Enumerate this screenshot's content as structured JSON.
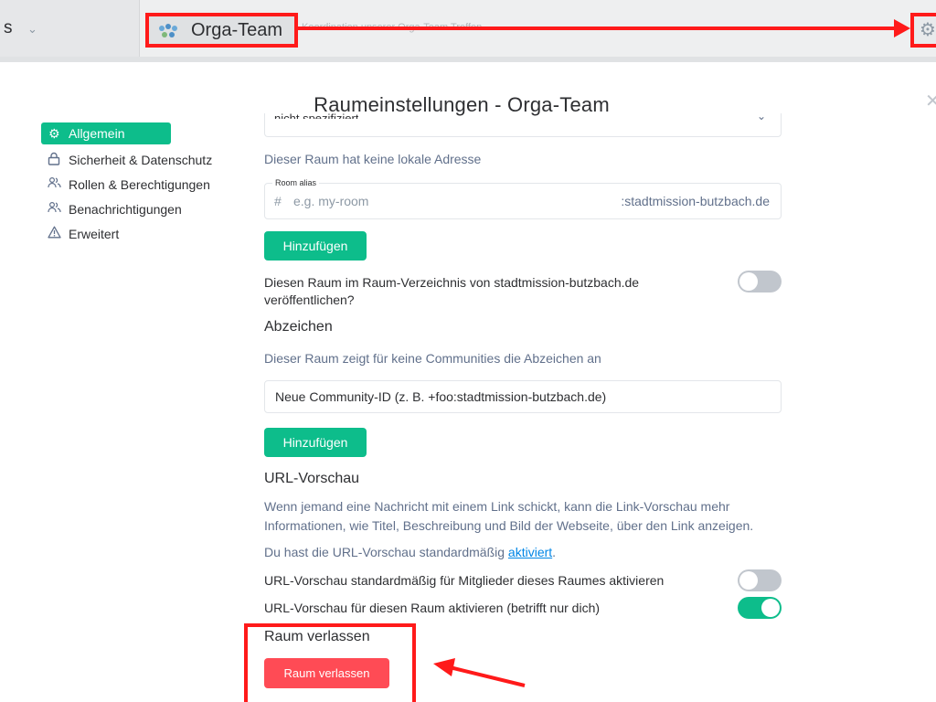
{
  "topbar": {
    "left_text": "s",
    "room_name": "Orga-Team",
    "room_topic": "Koordination unserer Orga-Team Treffen"
  },
  "dialog": {
    "title": "Raumeinstellungen - Orga-Team"
  },
  "sidebar": {
    "tabs": [
      {
        "label": "Allgemein",
        "icon": "gear-icon",
        "active": true
      },
      {
        "label": "Sicherheit & Datenschutz",
        "icon": "lock-icon"
      },
      {
        "label": "Rollen & Berechtigungen",
        "icon": "people-icon"
      },
      {
        "label": "Benachrichtigungen",
        "icon": "people-icon"
      },
      {
        "label": "Erweitert",
        "icon": "warning-icon"
      }
    ]
  },
  "general": {
    "partial_field_value": "nicht spezifiziert",
    "no_local_address": "Dieser Raum hat keine lokale Adresse",
    "alias": {
      "legend": "Room alias",
      "prefix": "#",
      "placeholder": "e.g. my-room",
      "domain": ":stadtmission-butzbach.de"
    },
    "add_button": "Hinzufügen",
    "publish_label": "Diesen Raum im Raum-Verzeichnis von stadtmission-butzbach.de veröffentlichen?",
    "publish_enabled": false
  },
  "flair": {
    "heading": "Abzeichen",
    "description": "Dieser Raum zeigt für keine Communities die Abzeichen an",
    "community_placeholder": "Neue Community-ID (z. B. +foo:stadtmission-butzbach.de)",
    "add_button": "Hinzufügen"
  },
  "url_preview": {
    "heading": "URL-Vorschau",
    "description": "Wenn jemand eine Nachricht mit einem Link schickt, kann die Link-Vorschau mehr Informationen, wie Titel, Beschreibung und Bild der Webseite, über den Link anzeigen.",
    "default_prefix": "Du hast die URL-Vorschau standardmäßig ",
    "default_link": "aktiviert",
    "default_suffix": ".",
    "members_label": "URL-Vorschau standardmäßig für Mitglieder dieses Raumes aktivieren",
    "members_enabled": false,
    "self_label": "URL-Vorschau für diesen Raum aktivieren (betrifft nur dich)",
    "self_enabled": true
  },
  "leave": {
    "heading": "Raum verlassen",
    "button": "Raum verlassen"
  },
  "colors": {
    "accent": "#0dbd8b",
    "danger": "#ff4b55",
    "annotation": "#ff1a1a"
  }
}
